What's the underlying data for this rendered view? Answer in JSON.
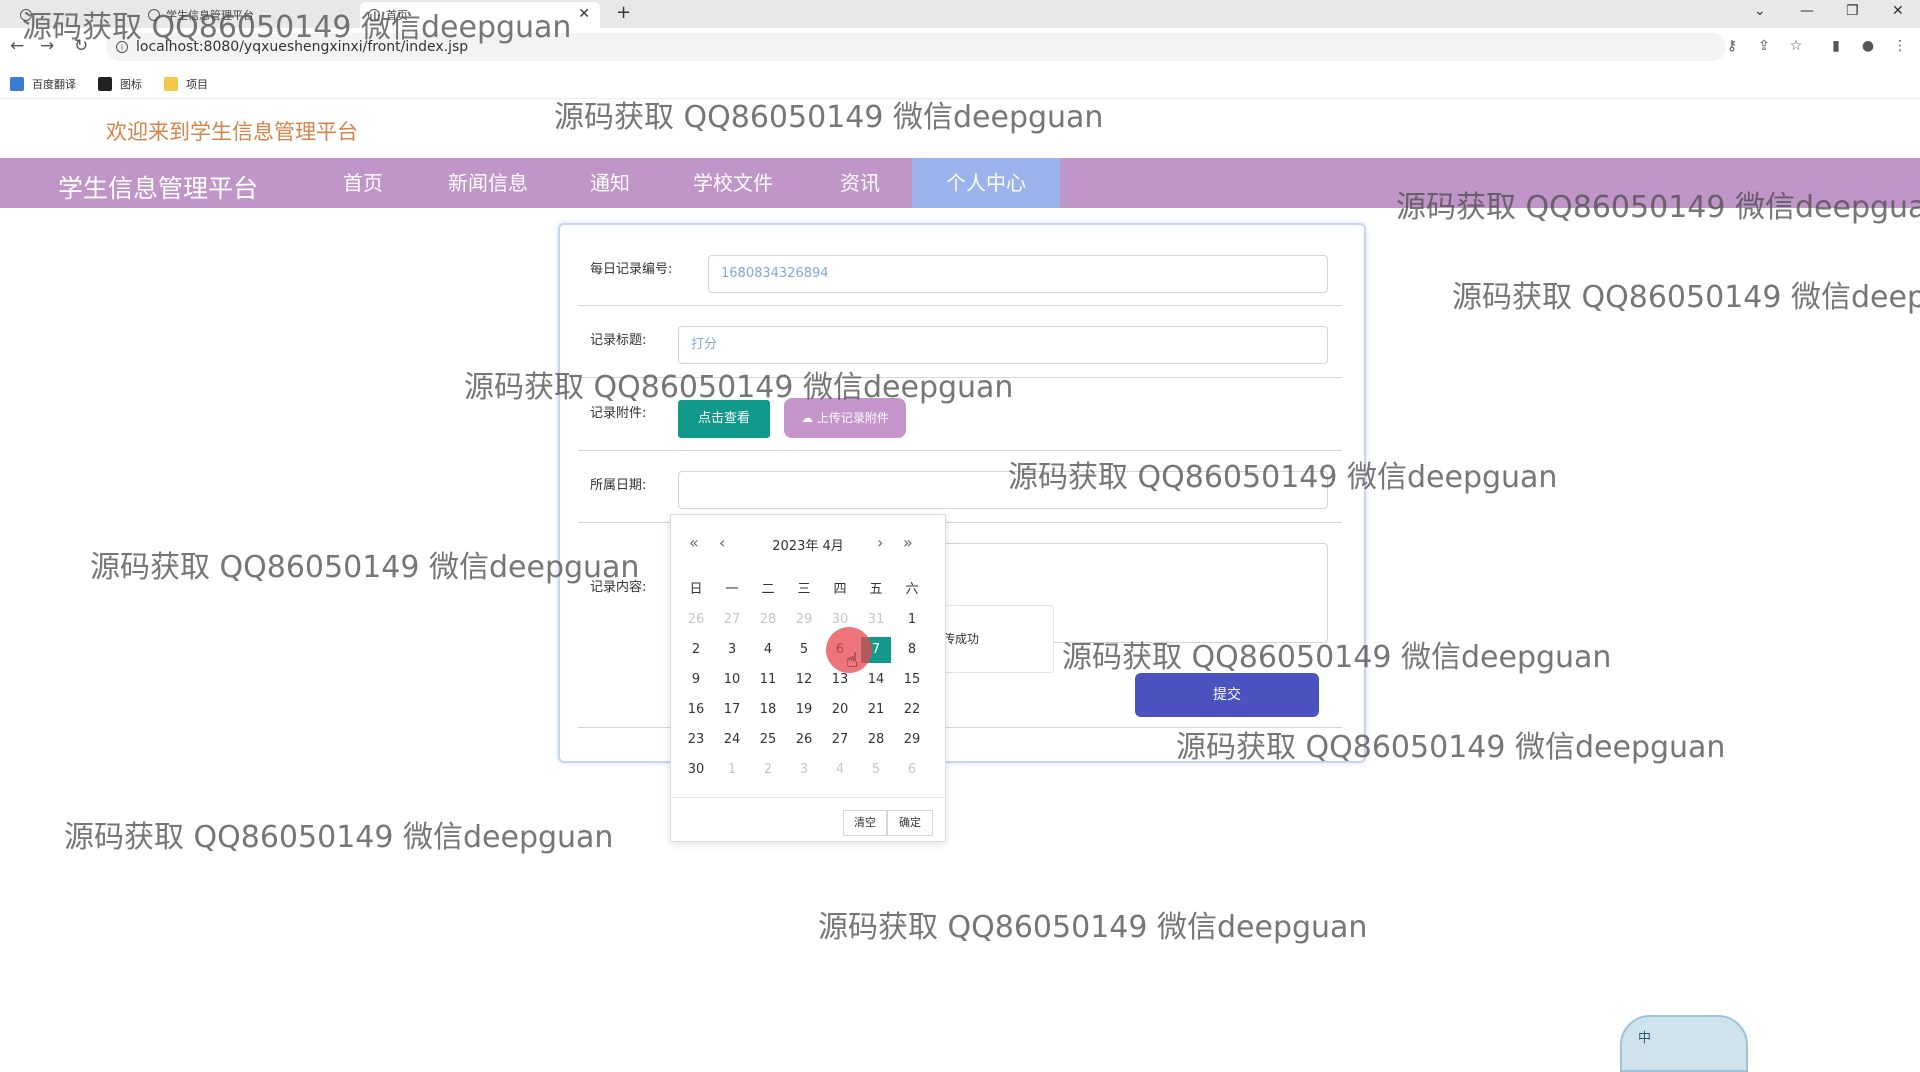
{
  "browser": {
    "tabs": [
      {
        "label": ""
      },
      {
        "label": "学生信息管理平台"
      },
      {
        "label": "首页"
      }
    ],
    "url": "localhost:8080/yqxueshengxinxi/front/index.jsp",
    "bookmarks": [
      "百度翻译",
      "图标",
      "项目"
    ]
  },
  "site": {
    "welcome": "欢迎来到学生信息管理平台",
    "brand": "学生信息管理平台",
    "nav": [
      "首页",
      "新闻信息",
      "通知",
      "学校文件",
      "资讯",
      "个人中心"
    ],
    "active_nav": "个人中心"
  },
  "form": {
    "record_no_label": "每日记录编号:",
    "record_no_value": "1680834326894",
    "title_label": "记录标题:",
    "title_value": "打分",
    "attachment_label": "记录附件:",
    "view_button": "点击查看",
    "upload_button": "上传记录附件",
    "date_label": "所属日期:",
    "date_value": "",
    "content_label": "记录内容:",
    "submit_button": "提交",
    "toast_text": "传成功"
  },
  "calendar": {
    "year_month": "2023年  4月",
    "weekdays": [
      "日",
      "一",
      "二",
      "三",
      "四",
      "五",
      "六"
    ],
    "clear_button": "清空",
    "confirm_button": "确定",
    "selected_day": "7",
    "highlighted_day": "6"
  },
  "watermark": "源码获取 QQ86050149 微信deepguan",
  "widget_label": "中",
  "colors": {
    "nav_bg": "#c095c8",
    "nav_active": "#9ab3ec",
    "teal": "#119a8c",
    "submit": "#4c52c0",
    "welcome": "#d2844a"
  }
}
